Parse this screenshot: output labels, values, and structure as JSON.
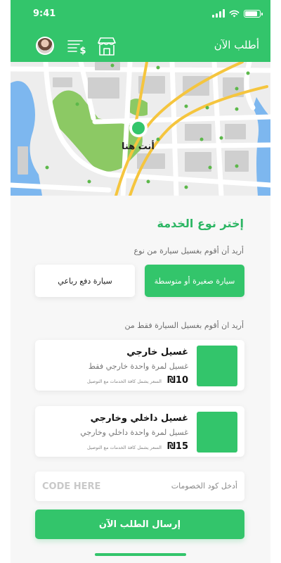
{
  "status_bar": {
    "time": "9:41"
  },
  "header": {
    "title": "أطلب الآن",
    "icons": [
      "avatar",
      "price-list-icon",
      "store-icon"
    ]
  },
  "map": {
    "pin_label": "أنت هنا"
  },
  "service": {
    "title": "إختر نوع الخدمة",
    "car_type_prompt": "أريد أن أقوم بغسيل سيارة من نوع",
    "car_types": [
      {
        "label": "سيارة صغيرة أو متوسطة",
        "selected": true
      },
      {
        "label": "سيارة دفع رباعي",
        "selected": false
      }
    ],
    "wash_prompt": "أريد ان أقوم بغسيل السيارة فقط من",
    "options": [
      {
        "name": "غسيل خارجي",
        "description": "غسيل لمرة واحدة خارجي فقط",
        "price": "₪10",
        "note": "السعر يشمل كافة الخدمات مع التوصيل"
      },
      {
        "name": "غسيل داخلي وخارجي",
        "description": "غسيل لمرة واحدة داخلي وخارجي",
        "price": "₪15",
        "note": "السعر يشمل كافة الخدمات مع التوصيل"
      }
    ]
  },
  "discount": {
    "label": "أدخل كود الخصومات",
    "placeholder": "CODE HERE"
  },
  "submit": {
    "label": "إرسال الطلب الآن"
  },
  "colors": {
    "accent": "#33c56b",
    "accent_text": "#2db664"
  }
}
